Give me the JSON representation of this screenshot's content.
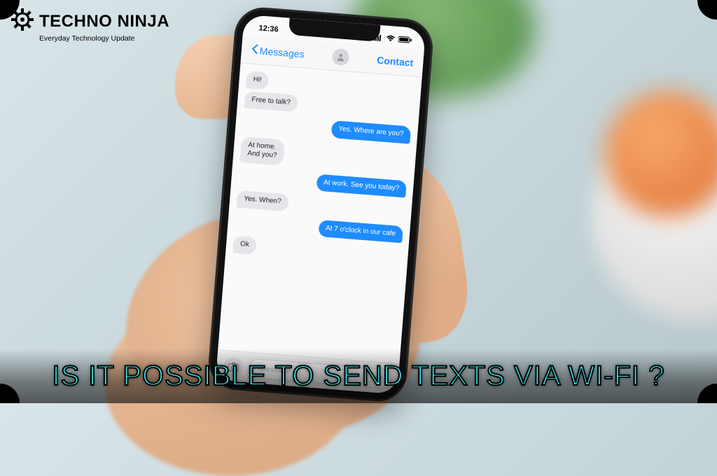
{
  "logo": {
    "brand_left": "TECHNO",
    "brand_right": "NINJA",
    "tagline": "Everyday Technology Update"
  },
  "phone": {
    "status": {
      "time": "12:36"
    },
    "nav": {
      "back_label": "Messages",
      "contact_label": "Contact"
    },
    "messages": [
      {
        "dir": "in",
        "text": "Hi!"
      },
      {
        "dir": "in",
        "text": "Free to talk?"
      },
      {
        "dir": "out",
        "text": "Yes. Where are you?"
      },
      {
        "dir": "in",
        "text": "At home.\nAnd you?"
      },
      {
        "dir": "out",
        "text": "At work. See you today?"
      },
      {
        "dir": "in",
        "text": "Yes. When?"
      },
      {
        "dir": "out",
        "text": "At 7 o'clock in our cafe"
      },
      {
        "dir": "in",
        "text": "Ok"
      }
    ],
    "input": {
      "placeholder": "iMessage"
    }
  },
  "caption": "IS IT POSSIBLE TO SEND TEXTS VIA WI-FI ?"
}
